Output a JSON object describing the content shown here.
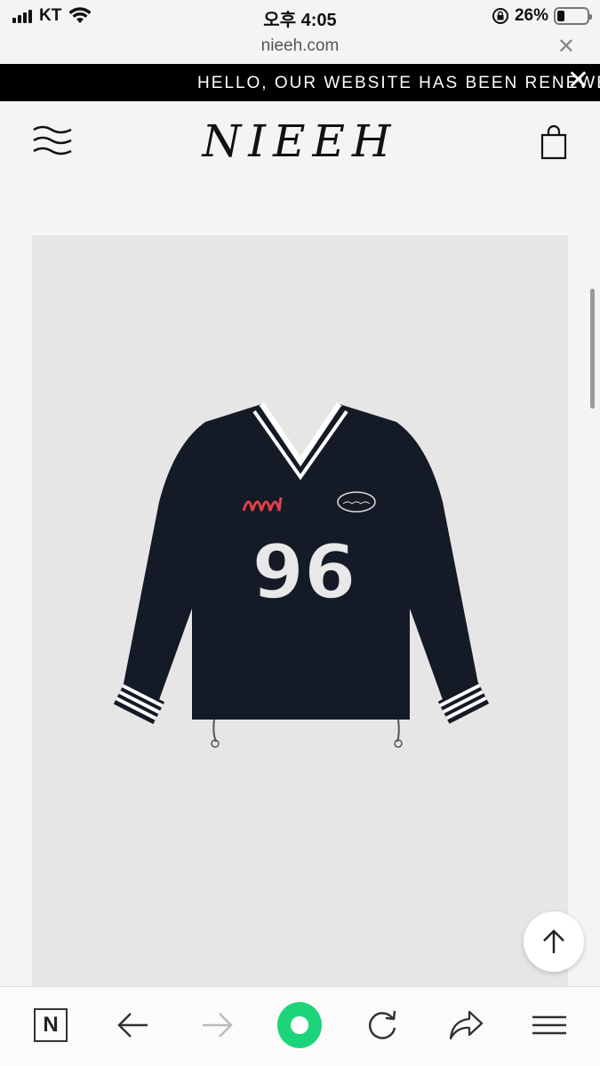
{
  "status_bar": {
    "carrier": "KT",
    "time": "오후 4:05",
    "battery_percent": "26%",
    "battery_level": 0.26
  },
  "url_bar": {
    "url": "nieeh.com",
    "close_icon": "close-icon"
  },
  "announcement": {
    "text": "HELLO, OUR WEBSITE HAS BEEN RENEWED!",
    "close_icon": "close-icon"
  },
  "header": {
    "logo_text": "NIEEH",
    "menu_icon": "menu-icon",
    "cart_icon": "shopping-bag-icon"
  },
  "product": {
    "image_description_icon": "sweatshirt-image",
    "jersey_number": "96"
  },
  "back_to_top_icon": "arrow-up-icon",
  "toolbar": {
    "n_label": "N",
    "icons": [
      "naver-n-icon",
      "back-arrow-icon",
      "forward-arrow-icon",
      "home-green-circle-icon",
      "reload-icon",
      "share-icon",
      "menu-lines-icon"
    ]
  },
  "colors": {
    "announcement_bg": "#000000",
    "page_bg": "#f4f4f4",
    "image_bg": "#e6e6e6",
    "shirt": "#141a26",
    "accent_green": "#1ed47a",
    "patch_red": "#e0404a"
  }
}
